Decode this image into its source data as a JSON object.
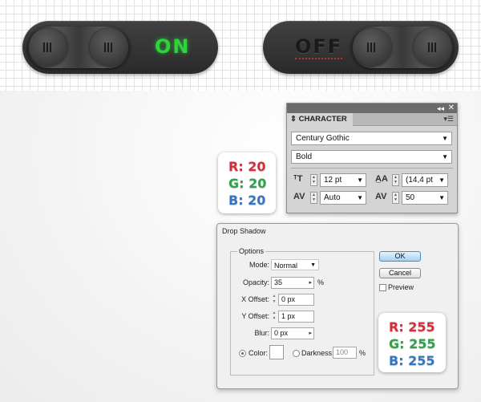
{
  "toggles": {
    "on": {
      "label": "ON",
      "color": "#2dd43c"
    },
    "off": {
      "label": "OFF",
      "color": "#1a1a1a"
    }
  },
  "rgb_small": {
    "r": "R: 20",
    "g": "G: 20",
    "b": "B: 20"
  },
  "rgb_large": {
    "r": "R: 255",
    "g": "G: 255",
    "b": "B: 255"
  },
  "colors": {
    "red": "#d32f3a",
    "green": "#2fa14a",
    "blue": "#3576c4"
  },
  "character_panel": {
    "collapse": "◂◂",
    "close": "✕",
    "tab": "⇕ CHARACTER",
    "font_family": "Century Gothic",
    "font_style": "Bold",
    "font_size": "12 pt",
    "leading": "(14,4 pt",
    "kerning": "Auto",
    "tracking": "50"
  },
  "drop_shadow": {
    "title": "Drop Shadow",
    "options_legend": "Options",
    "mode_label": "Mode:",
    "mode_value": "Normal",
    "opacity_label": "Opacity:",
    "opacity_value": "35",
    "opacity_unit": "%",
    "x_offset_label": "X Offset:",
    "x_offset_value": "0 px",
    "y_offset_label": "Y Offset:",
    "y_offset_value": "1 px",
    "blur_label": "Blur:",
    "blur_value": "0 px",
    "color_label": "Color:",
    "darkness_label": "Darkness:",
    "darkness_value": "100",
    "darkness_unit": "%",
    "ok_label": "OK",
    "cancel_label": "Cancel",
    "preview_label": "Preview"
  }
}
